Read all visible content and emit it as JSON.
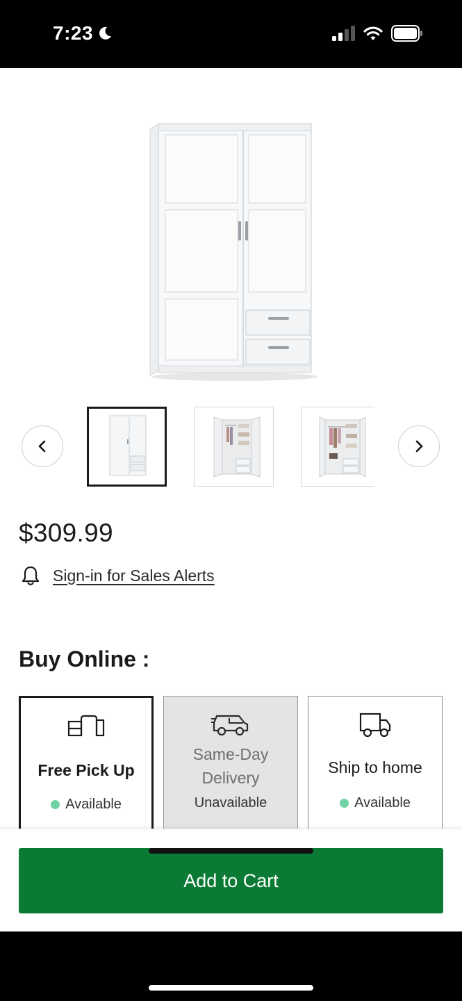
{
  "status_bar": {
    "time": "7:23"
  },
  "product": {
    "price": "$309.99",
    "sales_alert_link": "Sign-in for Sales Alerts",
    "thumbnails": [
      {
        "label": "Front view",
        "selected": true
      },
      {
        "label": "Open doors view",
        "selected": false
      },
      {
        "label": "Interior view",
        "selected": false
      }
    ]
  },
  "buy_online": {
    "heading": "Buy Online :",
    "options": [
      {
        "title": "Free Pick Up",
        "status": "Available",
        "icon": "store-pickup-icon",
        "selected": true
      },
      {
        "title": "Same-Day Delivery",
        "status": "Unavailable",
        "icon": "delivery-van-icon",
        "selected": false
      },
      {
        "title": "Ship to home",
        "status": "Available",
        "icon": "truck-icon",
        "selected": false
      }
    ]
  },
  "actions": {
    "add_to_cart": "Add to Cart"
  },
  "colors": {
    "cart_button": "#0a7a35",
    "available_dot": "#6fd3a4"
  }
}
